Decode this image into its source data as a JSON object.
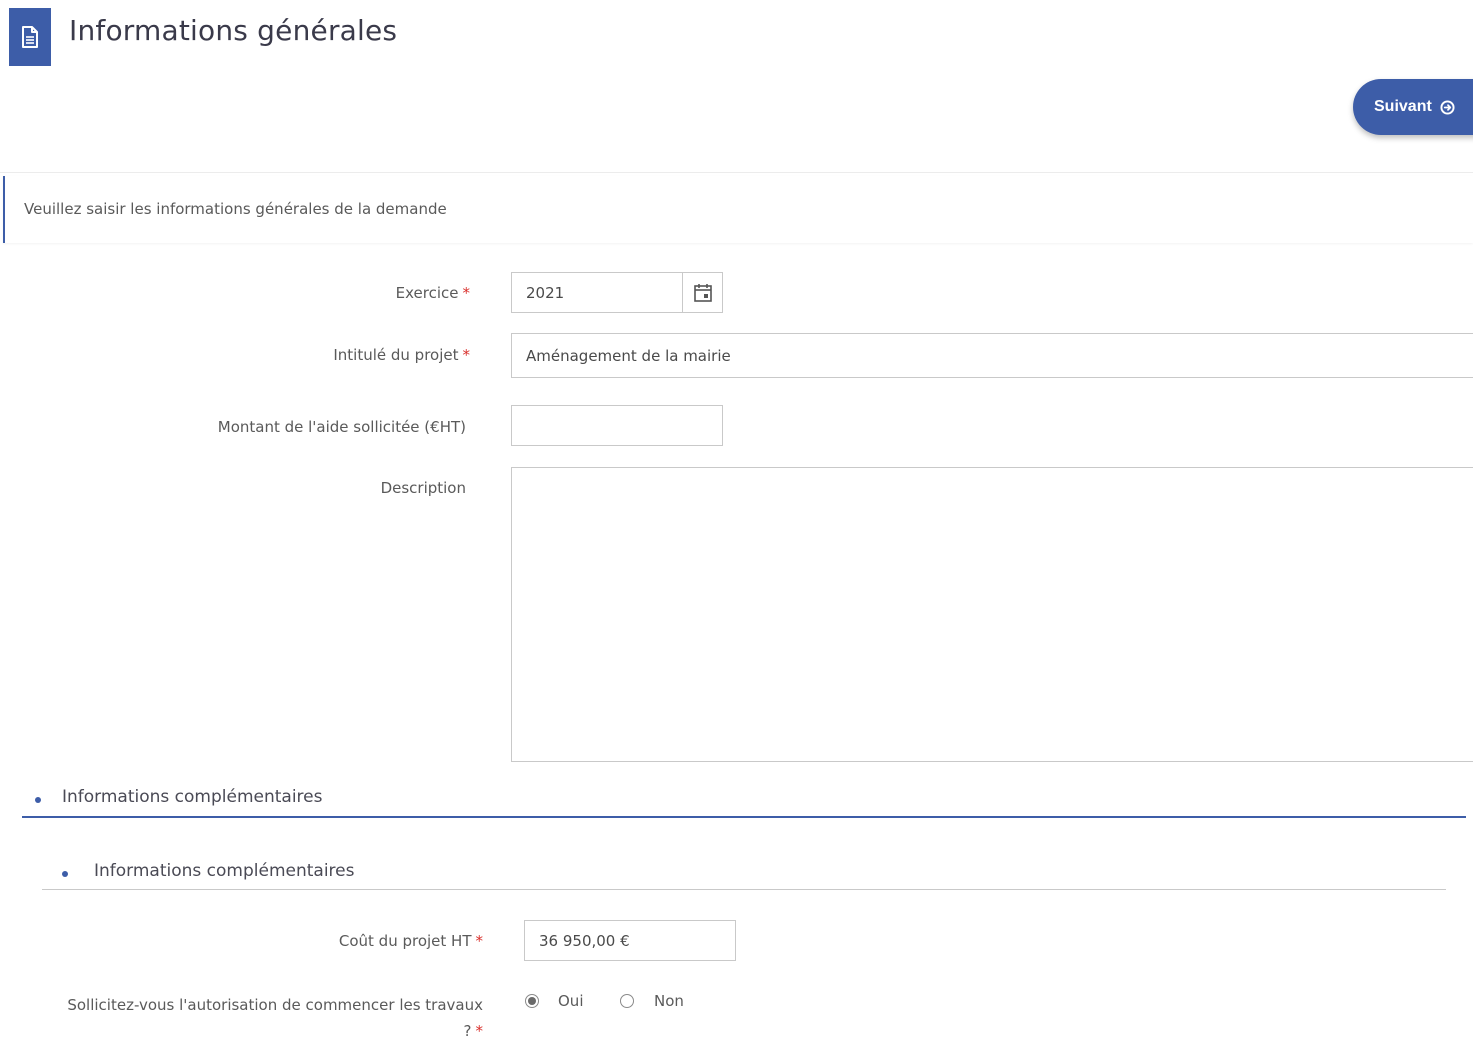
{
  "header": {
    "title": "Informations générales",
    "icon": "document-icon",
    "next_label": "Suivant",
    "next_icon": "arrow-right-circle-icon",
    "accent_color": "#3d5da8"
  },
  "info": {
    "text": "Veuillez saisir les informations générales de la demande"
  },
  "form": {
    "exercice": {
      "label": "Exercice",
      "required": "*",
      "value": "2021"
    },
    "intitule": {
      "label": "Intitulé du projet",
      "required": "*",
      "value": "Aménagement de la mairie"
    },
    "montant": {
      "label": "Montant de l'aide sollicitée (€HT)",
      "value": ""
    },
    "description": {
      "label": "Description",
      "value": ""
    }
  },
  "sections": {
    "outer_title": "Informations complémentaires",
    "inner_title": "Informations complémentaires"
  },
  "complementary": {
    "cout": {
      "label": "Coût du projet HT",
      "required": "*",
      "value": "36 950,00 €"
    },
    "autorisation": {
      "label_line1": "Sollicitez-vous l'autorisation de commencer les travaux",
      "label_line2": "?",
      "required": "*",
      "options": [
        "Oui",
        "Non"
      ],
      "selected": "Oui"
    }
  }
}
